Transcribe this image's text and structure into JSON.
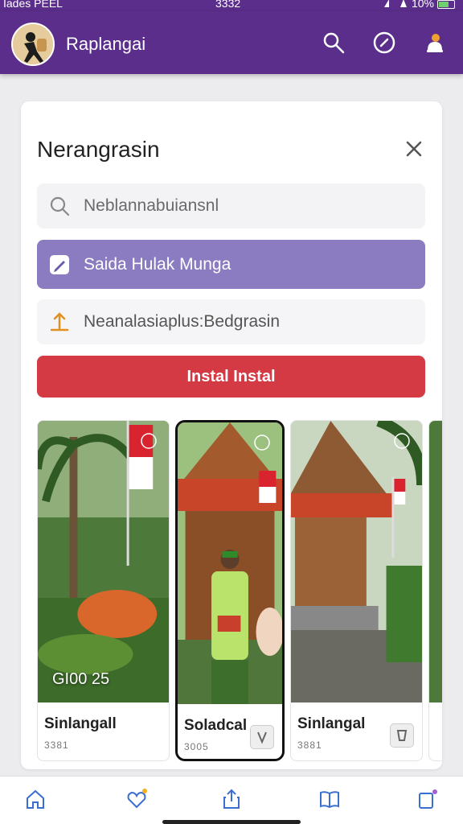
{
  "status_bar": {
    "carrier": "Iades PEEL",
    "time": "3332",
    "battery": "10%"
  },
  "app_bar": {
    "title": "Raplangai",
    "icons": [
      "search-icon",
      "chat-icon",
      "notification-icon"
    ]
  },
  "dialog": {
    "title": "Nerangrasin",
    "search_placeholder": "Neblannabuiansnl",
    "edit_value": "Saida Hulak Munga",
    "location_value": "Neanalasiaplus:Bedgrasin",
    "install_label": "Instal Instal"
  },
  "gallery": {
    "items": [
      {
        "name": "Sinlangall",
        "meta": "3381",
        "price": "GI00 25",
        "selected": false
      },
      {
        "name": "Soladcal",
        "meta": "3005",
        "price": "",
        "selected": true
      },
      {
        "name": "Sinlangal",
        "meta": "3881",
        "price": "",
        "selected": false
      }
    ]
  },
  "bottom_nav": {
    "items": [
      "home-icon",
      "favorites-icon",
      "share-icon",
      "library-icon",
      "pages-icon"
    ]
  },
  "colors": {
    "brand": "#5b2e8c",
    "edit_field": "#8b7cc1",
    "install": "#d33a44"
  }
}
